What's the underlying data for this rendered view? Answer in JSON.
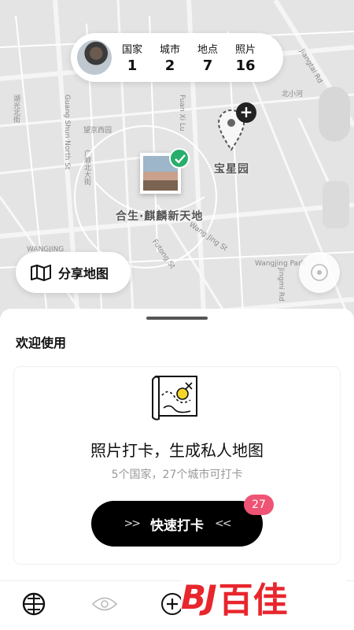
{
  "stats": {
    "items": [
      {
        "label": "国家",
        "value": "1"
      },
      {
        "label": "城市",
        "value": "2"
      },
      {
        "label": "地点",
        "value": "7"
      },
      {
        "label": "照片",
        "value": "16"
      }
    ]
  },
  "map": {
    "labels": [
      "WANGJING",
      "Guang Shun North St",
      "Fuan Xi Lu",
      "Wang Jing St",
      "Futong St",
      "Jingmi Rd",
      "Jiangtai Rd",
      "北小河",
      "湖光北街",
      "望京西园",
      "广顺北大街",
      "Wangjing Park"
    ],
    "pin_label": "宝星园",
    "photo_label": "合生·麒麟新天地"
  },
  "share_button": {
    "label": "分享地图"
  },
  "sheet": {
    "welcome": "欢迎使用",
    "card_title": "照片打卡，生成私人地图",
    "card_subtitle": "5个国家，27个城市可打卡",
    "checkin_label": "快速打卡",
    "checkin_left": ">>",
    "checkin_right": "<<",
    "badge_count": "27"
  },
  "tabbar": {
    "icons": [
      "globe-icon",
      "eye-icon",
      "add-icon"
    ]
  },
  "watermark": {
    "logo": "BJ",
    "text": "百佳"
  },
  "colors": {
    "accent_green": "#27ae6b",
    "badge_pink": "#ef5374",
    "watermark_red": "#e8262d",
    "button_black": "#000000"
  }
}
